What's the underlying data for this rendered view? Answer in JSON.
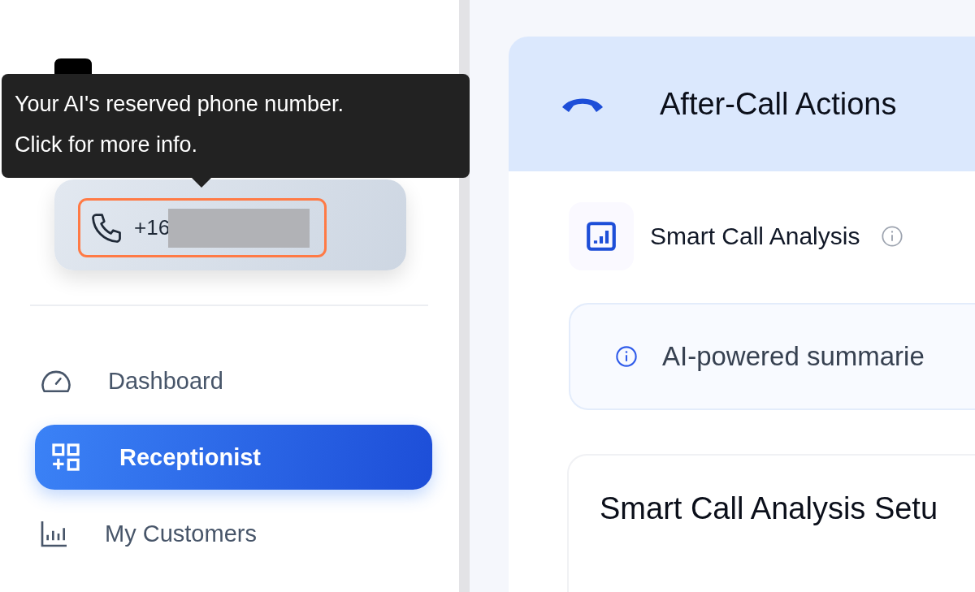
{
  "sidebar": {
    "tooltip": {
      "lines": [
        "Your AI's reserved phone number.",
        "Click for more info."
      ]
    },
    "phone": {
      "number": "+16",
      "highlighted": true
    },
    "nav_items": [
      {
        "label": "Dashboard",
        "selected": false
      },
      {
        "label": "Receptionist",
        "selected": true
      },
      {
        "label": "My Customers",
        "selected": false
      }
    ]
  },
  "main": {
    "header": {
      "title": "After-Call Actions"
    },
    "feature": {
      "title": "Smart Call Analysis"
    },
    "info_banner": {
      "text": "AI-powered summarie"
    },
    "setup_card": {
      "title": "Smart Call Analysis Setu"
    }
  }
}
